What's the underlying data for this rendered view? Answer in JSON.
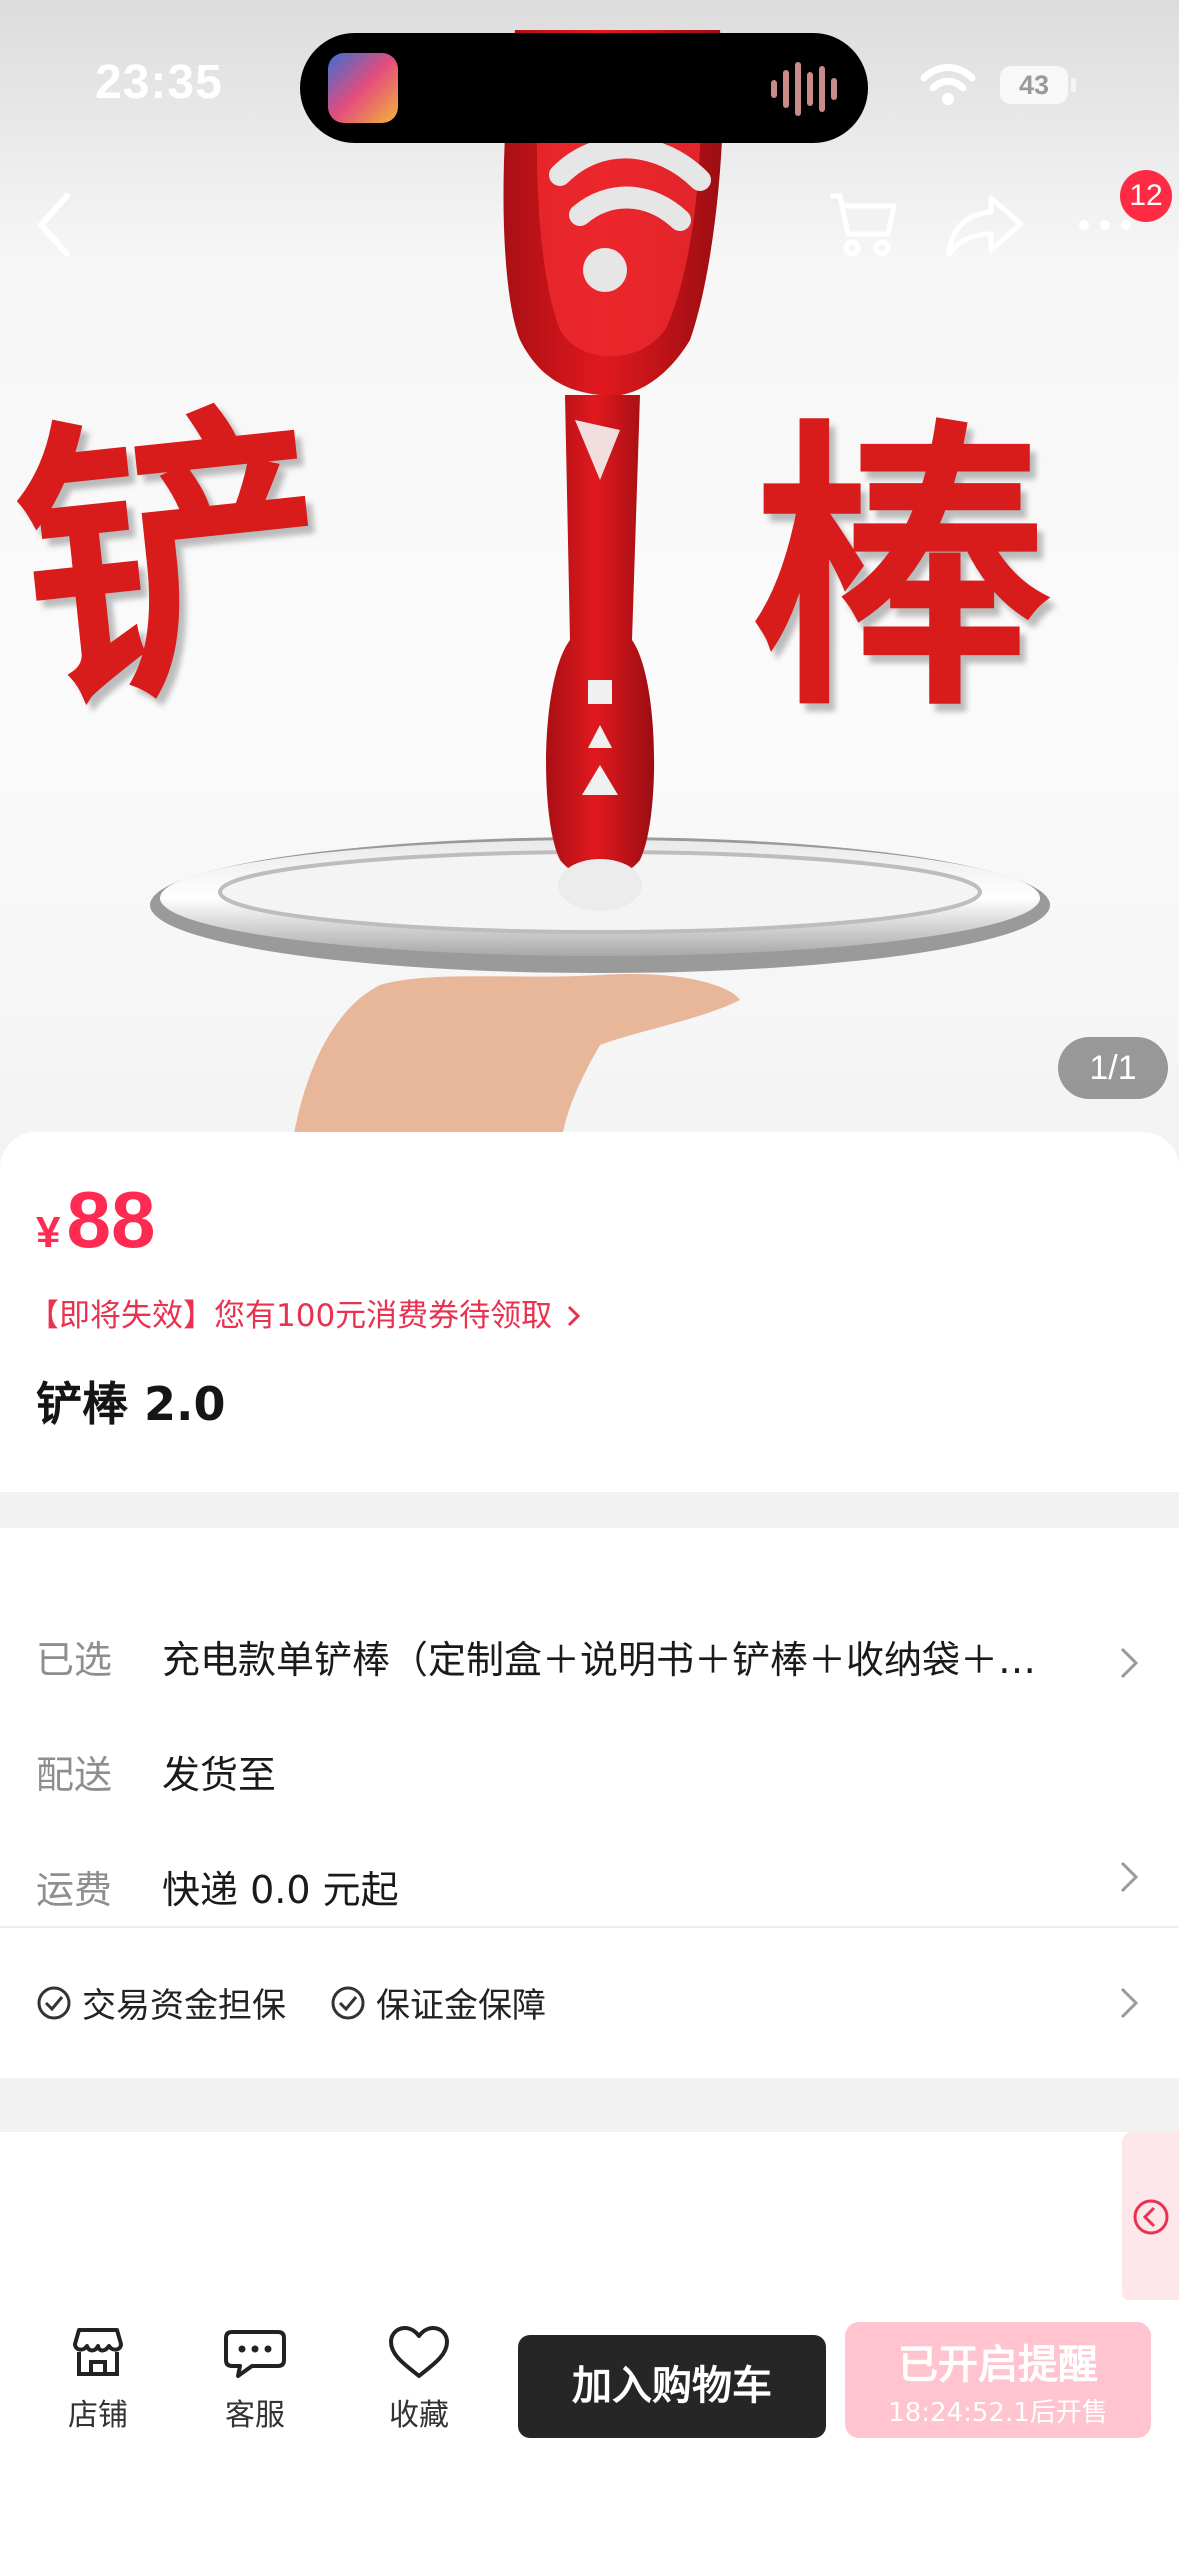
{
  "status_bar": {
    "time": "23:35",
    "battery": "43"
  },
  "nav": {
    "cart_badge": "12"
  },
  "hero": {
    "chars": [
      "铲",
      "棒"
    ],
    "counter": "1/1"
  },
  "product": {
    "currency": "¥",
    "price": "88",
    "coupon": "【即将失效】您有100元消费券待领取",
    "title": "铲棒 2.0"
  },
  "options": [
    {
      "label": "已选",
      "value": "充电款单铲棒（定制盒＋说明书＋铲棒＋收纳袋＋…"
    },
    {
      "label": "配送",
      "value": "发货至"
    },
    {
      "label": "运费",
      "value": "快递 0.0 元起"
    }
  ],
  "guarantees": [
    "交易资金担保",
    "保证金保障"
  ],
  "bottom_bar": {
    "tabs": [
      "店铺",
      "客服",
      "收藏"
    ],
    "add_to_cart": "加入购物车",
    "reminder": "已开启提醒",
    "reminder_sub": "18:24:52.1后开售"
  },
  "colors": {
    "accent": "#ff2a52",
    "badge": "#ff2a44",
    "dark_button": "#262626",
    "reminder_button": "#ffc4d0"
  }
}
